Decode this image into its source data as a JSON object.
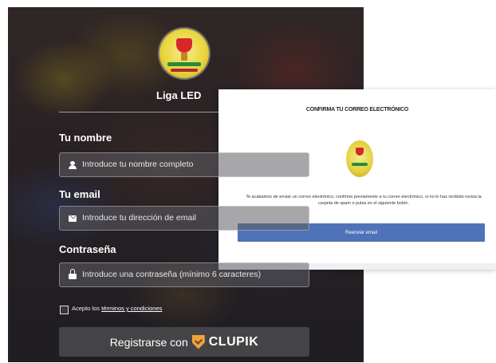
{
  "signup": {
    "brand": "Liga LED",
    "name_label": "Tu nombre",
    "name_placeholder": "Introduce tu nombre completo",
    "email_label": "Tu email",
    "email_placeholder": "Introduce tu dirección de email",
    "password_label": "Contraseña",
    "password_placeholder": "Introduce una contraseña (mínimo 6 caracteres)",
    "terms_prefix": "Acepto los ",
    "terms_link": "términos y condiciones",
    "register_label": "Registrarse con",
    "register_brand": "CLUPIK",
    "icons": [
      "user-icon",
      "mail-icon",
      "lock-icon",
      "clupik-shield-icon"
    ]
  },
  "confirm": {
    "title": "CONFIRMA TU CORREO ELECTRÓNICO",
    "body": "Te acabamos de enviar un correo electrónico, confirma previamente a tu correo electrónico, si no lo has recibido revisa la carpeta de spam o pulsa en el siguiente botón.",
    "button_label": "Reenviar email",
    "accent_color": "#4e73b9"
  }
}
